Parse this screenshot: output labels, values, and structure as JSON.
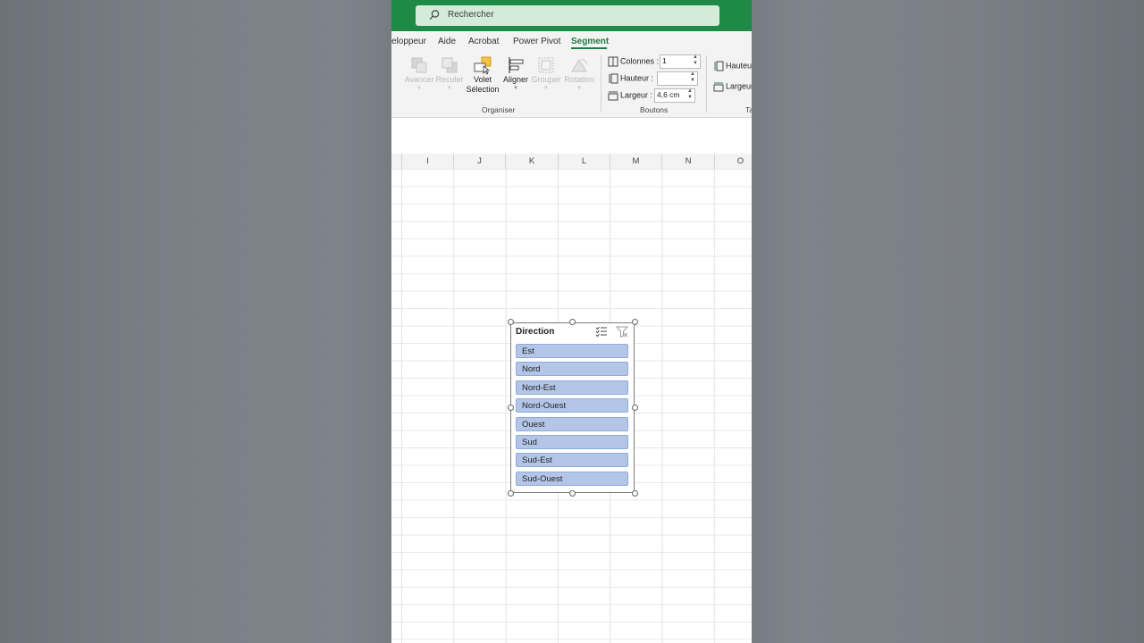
{
  "search": {
    "placeholder": "Rechercher",
    "icon": "search-icon"
  },
  "tabs": [
    {
      "label": "eloppeur",
      "active": false
    },
    {
      "label": "Aide",
      "active": false
    },
    {
      "label": "Acrobat",
      "active": false
    },
    {
      "label": "Power Pivot",
      "active": false
    },
    {
      "label": "Segment",
      "active": true
    }
  ],
  "ribbon": {
    "organiser": {
      "label": "Organiser",
      "buttons": [
        {
          "label": "Avancer",
          "enabled": false
        },
        {
          "label": "Reculer",
          "enabled": false
        },
        {
          "label": "Volet",
          "label2": "Sélection",
          "enabled": true
        },
        {
          "label": "Aligner",
          "enabled": true
        },
        {
          "label": "Grouper",
          "enabled": false
        },
        {
          "label": "Rotation",
          "enabled": false
        }
      ]
    },
    "boutons": {
      "label": "Boutons",
      "colonnes": {
        "label": "Colonnes :",
        "value": "1"
      },
      "hauteur": {
        "label": "Hauteur :",
        "value": ""
      },
      "largeur": {
        "label": "Largeur :",
        "value": "4,6 cm"
      }
    },
    "taille": {
      "label": "Ta",
      "hauteur": "Hauteu",
      "largeur": "Largeur"
    }
  },
  "columns": [
    "I",
    "J",
    "K",
    "L",
    "M",
    "N",
    "O"
  ],
  "slicer": {
    "title": "Direction",
    "items": [
      "Est",
      "Nord",
      "Nord-Est",
      "Nord-Ouest",
      "Ouest",
      "Sud",
      "Sud-Est",
      "Sud-Ouest"
    ],
    "item_color": "#b4c6e7"
  },
  "colors": {
    "brand": "#1e8a46",
    "active_tab": "#1e7b43"
  }
}
